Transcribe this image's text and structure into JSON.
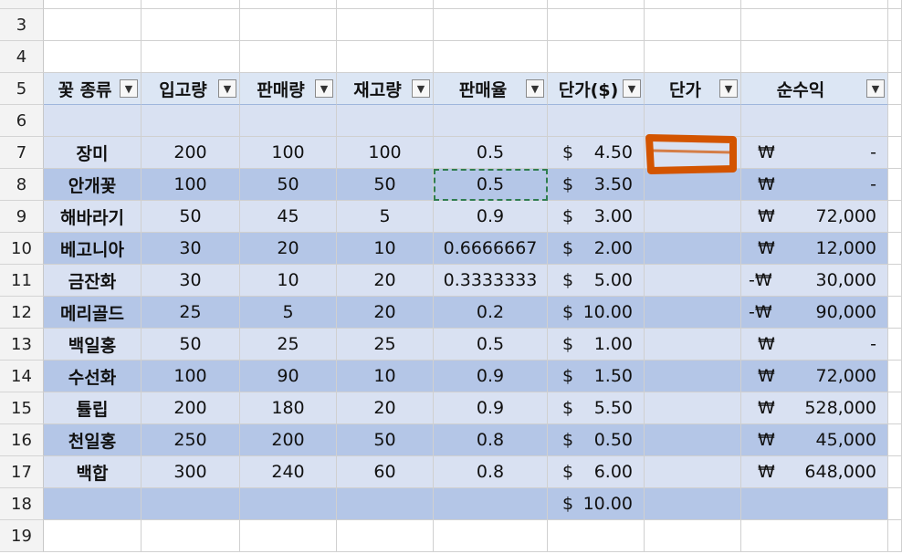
{
  "rows": [
    "3",
    "4",
    "5",
    "6",
    "7",
    "8",
    "9",
    "10",
    "11",
    "12",
    "13",
    "14",
    "15",
    "16",
    "17",
    "18",
    "19"
  ],
  "headers": [
    "꽃 종류",
    "입고량",
    "판매량",
    "재고량",
    "판매율",
    "단가($)",
    "단가",
    "순수익"
  ],
  "data": [
    [
      "장미",
      "200",
      "100",
      "100",
      "0.5",
      "4.50",
      "",
      "-"
    ],
    [
      "안개꽃",
      "100",
      "50",
      "50",
      "0.5",
      "3.50",
      "",
      "-"
    ],
    [
      "해바라기",
      "50",
      "45",
      "5",
      "0.9",
      "3.00",
      "",
      "72,000"
    ],
    [
      "베고니아",
      "30",
      "20",
      "10",
      "0.6666667",
      "2.00",
      "",
      "12,000"
    ],
    [
      "금잔화",
      "30",
      "10",
      "20",
      "0.3333333",
      "5.00",
      "",
      "30,000"
    ],
    [
      "메리골드",
      "25",
      "5",
      "20",
      "0.2",
      "10.00",
      "",
      "90,000"
    ],
    [
      "백일홍",
      "50",
      "25",
      "25",
      "0.5",
      "1.00",
      "",
      "-"
    ],
    [
      "수선화",
      "100",
      "90",
      "10",
      "0.9",
      "1.50",
      "",
      "72,000"
    ],
    [
      "튤립",
      "200",
      "180",
      "20",
      "0.9",
      "5.50",
      "",
      "528,000"
    ],
    [
      "천일홍",
      "250",
      "200",
      "50",
      "0.8",
      "0.50",
      "",
      "45,000"
    ],
    [
      "백합",
      "300",
      "240",
      "60",
      "0.8",
      "6.00",
      "",
      "648,000"
    ]
  ],
  "profit_signs": [
    "₩",
    "₩",
    "₩",
    "₩",
    "-₩",
    "-₩",
    "₩",
    "₩",
    "₩",
    "₩",
    "₩"
  ],
  "row18_price": "10.00",
  "dollar": "$",
  "filter_icon": "dropdown-arrow-icon",
  "selected_cell": "E8",
  "colors": {
    "header_band": "#dce6f4",
    "band_light": "#d9e1f2",
    "band_dark": "#b4c6e7",
    "annotation": "#d35400"
  }
}
